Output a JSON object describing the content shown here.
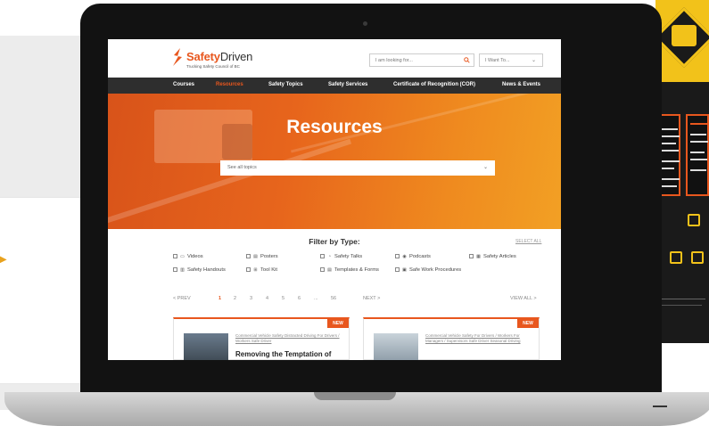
{
  "brand": {
    "name_accent": "Safety",
    "name_rest": "Driven",
    "tagline": "Trucking Safety Council of BC"
  },
  "search": {
    "placeholder": "I am looking for..."
  },
  "want_select": {
    "label": "I Want To..."
  },
  "nav": {
    "items": [
      "Courses",
      "Resources",
      "Safety Topics",
      "Safety Services",
      "Certificate of Recognition (COR)",
      "News & Events"
    ],
    "active": "Resources"
  },
  "hero": {
    "title": "Resources",
    "topic_select": "See all topics"
  },
  "filter": {
    "title": "Filter by Type:",
    "select_all": "SELECT ALL",
    "items": [
      {
        "label": "Videos",
        "icon": "video-icon"
      },
      {
        "label": "Posters",
        "icon": "poster-icon"
      },
      {
        "label": "Safety Talks",
        "icon": "talk-icon"
      },
      {
        "label": "Podcasts",
        "icon": "podcast-icon"
      },
      {
        "label": "Safety Articles",
        "icon": "article-icon"
      },
      {
        "label": "Safety Handouts",
        "icon": "handout-icon"
      },
      {
        "label": "Tool Kit",
        "icon": "toolkit-icon"
      },
      {
        "label": "Templates & Forms",
        "icon": "form-icon"
      },
      {
        "label": "Safe Work Procedures",
        "icon": "procedure-icon"
      }
    ]
  },
  "pagination": {
    "prev": "< PREV",
    "pages": [
      "1",
      "2",
      "3",
      "4",
      "5",
      "6",
      "...",
      "56"
    ],
    "current": "1",
    "next": "NEXT >",
    "view_all": "VIEW ALL >"
  },
  "cards": [
    {
      "badge": "NEW",
      "tags": "Commercial Vehicle Safety  Distracted Driving  For Drivers / Workers  Safe Driver",
      "title": "Removing the Temptation of"
    },
    {
      "badge": "NEW",
      "tags": "Commercial Vehicle Safety  For Drivers / Workers  For Managers / Supervisors  Safe Driver  Seasonal Driving",
      "title": ""
    }
  ],
  "colors": {
    "accent": "#e8571e",
    "nav_bg": "#2e2e2e",
    "poster_yellow": "#f2c21a"
  }
}
